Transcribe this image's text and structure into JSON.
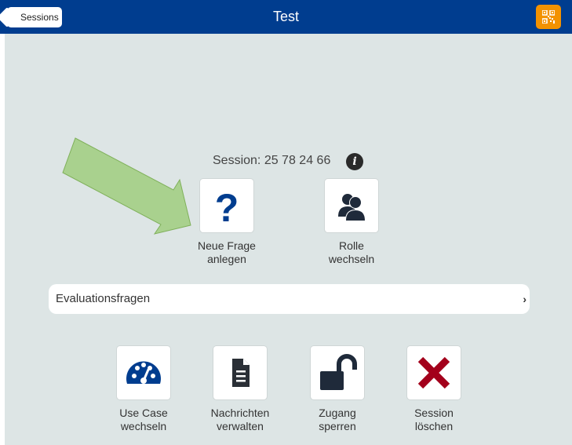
{
  "header": {
    "back_label": "Sessions",
    "title": "Test",
    "qr_icon": "qr-code-icon"
  },
  "session": {
    "text": "Session: 25 78 24 66",
    "info_icon": "i"
  },
  "top_actions": [
    {
      "label": "Neue Frage\nanlegen",
      "icon": "question-icon"
    },
    {
      "label": "Rolle\nwechseln",
      "icon": "users-icon"
    }
  ],
  "evaluation_bar": {
    "label": "Evaluationsfragen",
    "chevron": "›"
  },
  "bottom_actions": [
    {
      "label": "Use Case\nwechseln",
      "icon": "dashboard-icon"
    },
    {
      "label": "Nachrichten\nverwalten",
      "icon": "document-icon"
    },
    {
      "label": "Zugang\nsperren",
      "icon": "unlock-icon"
    },
    {
      "label": "Session\nlöschen",
      "icon": "delete-x-icon"
    }
  ],
  "colors": {
    "header": "#003d8f",
    "background": "#dde5e5",
    "accent_orange": "#f39200",
    "icon_blue": "#003d8f",
    "delete_red": "#a3001b",
    "annotation_arrow": "#a9d18e"
  }
}
